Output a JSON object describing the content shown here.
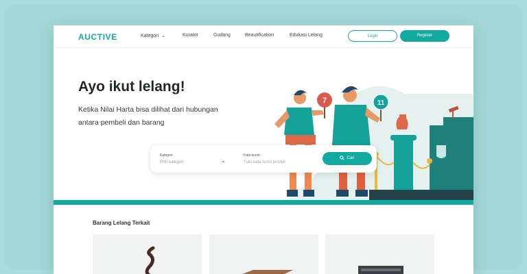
{
  "brand": {
    "logo": "AUCTIVE",
    "accent": "#12a9a0"
  },
  "nav": {
    "items": [
      {
        "label": "Kategori",
        "has_dropdown": true
      },
      {
        "label": "Kurator"
      },
      {
        "label": "Gudang"
      },
      {
        "label": "Beautification"
      },
      {
        "label": "Edukasi Lelang"
      }
    ],
    "login": "Login",
    "register": "Register"
  },
  "hero": {
    "title": "Ayo ikut lelang!",
    "subtitle": "Ketika Nilai Harta bisa dilihat dari hubungan antara pembeli dan barang",
    "bid_numbers": [
      "7",
      "11"
    ]
  },
  "search": {
    "category_label": "Kategori",
    "category_placeholder": "Pilih kategori",
    "keyword_label": "Kata kunci",
    "keyword_placeholder": "Tulis kata kunci produk",
    "button": "Cari"
  },
  "related": {
    "title": "Barang Lelang Terkait",
    "items": [
      {
        "image": "bronze-sculpture"
      },
      {
        "image": "wooden-box"
      },
      {
        "image": "antique-chest"
      }
    ]
  }
}
